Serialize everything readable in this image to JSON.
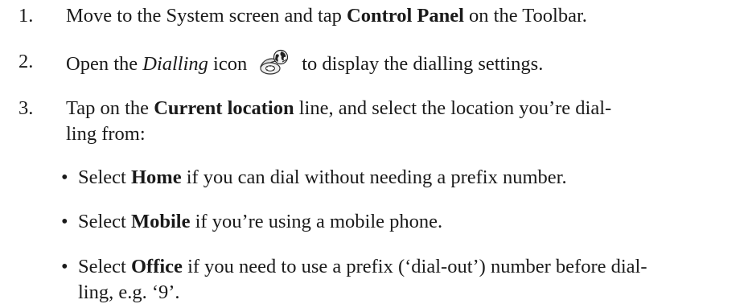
{
  "steps": [
    {
      "number": "1.",
      "pre": "Move to the System screen and tap ",
      "bold": "Control Panel",
      "post": " on the Toolbar."
    },
    {
      "number": "2.",
      "pre": "Open the ",
      "italic": "Dialling",
      "mid": " icon",
      "icon": "dialling-icon",
      "post": "to display the dialling settings."
    },
    {
      "number": "3.",
      "pre": "Tap on the ",
      "bold": "Current location",
      "post": " line, and select the location you’re dial-",
      "line2": "ling from:"
    }
  ],
  "bullets": [
    {
      "symbol": "•",
      "pre": "Select ",
      "bold": "Home",
      "post": " if you can dial without needing a prefix number."
    },
    {
      "symbol": "•",
      "pre": "Select ",
      "bold": "Mobile",
      "post": " if you’re using a mobile phone."
    },
    {
      "symbol": "•",
      "pre": "Select ",
      "bold": "Office",
      "post": " if you need to use a prefix (‘dial-out’) number before dial-",
      "line2": "ling, e.g. ‘9’."
    }
  ]
}
